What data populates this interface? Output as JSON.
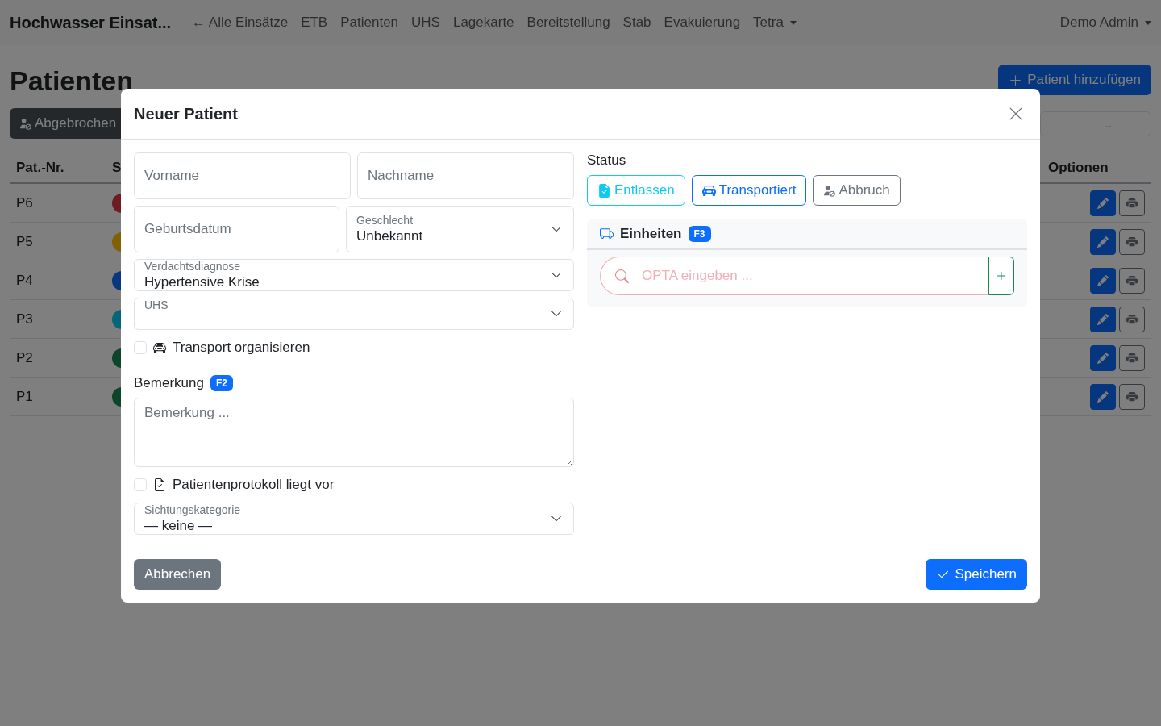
{
  "navbar": {
    "brand": "Hochwasser Einsat...",
    "links": [
      {
        "label": "← Alle Einsätze",
        "dropdown": false
      },
      {
        "label": "ETB",
        "dropdown": false
      },
      {
        "label": "Patienten",
        "dropdown": false
      },
      {
        "label": "UHS",
        "dropdown": false
      },
      {
        "label": "Lagekarte",
        "dropdown": false
      },
      {
        "label": "Bereitstellung",
        "dropdown": false
      },
      {
        "label": "Stab",
        "dropdown": false
      },
      {
        "label": "Evakuierung",
        "dropdown": false
      },
      {
        "label": "Tetra",
        "dropdown": true
      }
    ],
    "user": {
      "label": "Demo Admin",
      "dropdown": true
    }
  },
  "page": {
    "title": "Patienten",
    "add_button": "Patient hinzufügen",
    "filter_button": "Abgebrochen",
    "search": {
      "placeholder": "..."
    },
    "table": {
      "columns": [
        "Pat.-Nr.",
        "S",
        "Optionen"
      ],
      "rows": [
        {
          "number": "P6",
          "color": "#6e1b23"
        },
        {
          "number": "P5",
          "color": "#806104"
        },
        {
          "number": "P4",
          "color": "#07377f"
        },
        {
          "number": "P3",
          "color": "#076578"
        },
        {
          "number": "P2",
          "color": "#0d442a"
        },
        {
          "number": "P1",
          "color": "#0d442a"
        }
      ]
    }
  },
  "modal": {
    "title": "Neuer Patient",
    "rows": [
      [
        {
          "kind": "input",
          "placeholder": "Vorname"
        },
        {
          "kind": "input",
          "placeholder": "Nachname"
        }
      ],
      [
        {
          "kind": "input",
          "placeholder": "Geburtsdatum"
        },
        {
          "kind": "select",
          "label": "Geschlecht",
          "value": "Unbekannt"
        }
      ],
      [
        {
          "kind": "select",
          "label": "Verdachtsdiagnose",
          "value": "Hypertensive Krise"
        }
      ],
      [
        {
          "kind": "select",
          "label": "UHS"
        }
      ],
      [
        {
          "kind": "checkbox",
          "label": "Transport organisieren",
          "checked": false
        }
      ],
      [
        {
          "kind": "textarea",
          "label": "Bemerkung",
          "badge": "F2",
          "placeholder": "Bemerkung ..."
        }
      ],
      [
        {
          "kind": "checkbox",
          "label": "Patientenprotokoll liegt vor",
          "checked": false
        }
      ],
      [
        {
          "kind": "select",
          "label": "Sichtungskategorie",
          "value": "— keine —"
        }
      ]
    ],
    "status": {
      "label": "Status",
      "buttons": [
        {
          "kind": "discharged",
          "label": "Entlassen",
          "selected": false
        },
        {
          "kind": "transported",
          "label": "Transportiert",
          "selected": false
        },
        {
          "kind": "aborted",
          "label": "Abbruch",
          "selected": false
        }
      ]
    },
    "units": {
      "title": "Einheiten",
      "badge": "F3",
      "search": {
        "placeholder": "OPTA eingeben ..."
      }
    },
    "cancel_button": "Abbrechen",
    "save_button": "Speichern"
  }
}
